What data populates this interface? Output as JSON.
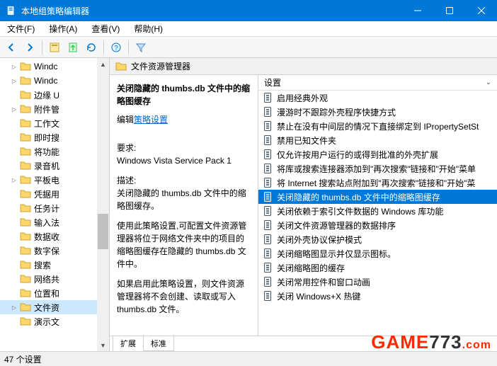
{
  "window": {
    "title": "本地组策略编辑器"
  },
  "menu": {
    "file": "文件(F)",
    "action": "操作(A)",
    "view": "查看(V)",
    "help": "帮助(H)"
  },
  "tree": {
    "items": [
      {
        "label": "Windc",
        "exp": "▷"
      },
      {
        "label": "Windc",
        "exp": "▷"
      },
      {
        "label": "边缘 U",
        "exp": " "
      },
      {
        "label": "附件管",
        "exp": "▷"
      },
      {
        "label": "工作文",
        "exp": " "
      },
      {
        "label": "即时搜",
        "exp": " "
      },
      {
        "label": "将功能",
        "exp": " "
      },
      {
        "label": "录音机",
        "exp": " "
      },
      {
        "label": "平板电",
        "exp": "▷"
      },
      {
        "label": "凭据用",
        "exp": " "
      },
      {
        "label": "任务计",
        "exp": " "
      },
      {
        "label": "输入法",
        "exp": " "
      },
      {
        "label": "数据收",
        "exp": " "
      },
      {
        "label": "数字保",
        "exp": " "
      },
      {
        "label": "搜索",
        "exp": " "
      },
      {
        "label": "网络共",
        "exp": " "
      },
      {
        "label": "位置和",
        "exp": " "
      },
      {
        "label": "文件资",
        "exp": "▷",
        "selected": true
      },
      {
        "label": "演示文",
        "exp": " "
      }
    ]
  },
  "path": {
    "title": "文件资源管理器"
  },
  "desc": {
    "heading": "关闭隐藏的 thumbs.db 文件中的缩略图缓存",
    "edit_prefix": "编辑",
    "edit_link": "策略设置",
    "req_label": "要求:",
    "req_text": "Windows Vista Service Pack 1",
    "desc_label": "描述:",
    "desc_p1": "关闭隐藏的 thumbs.db 文件中的缩略图缓存。",
    "desc_p2": "使用此策略设置,可配置文件资源管理器将位于网络文件夹中的项目的缩略图缓存在隐藏的 thumbs.db 文件中。",
    "desc_p3": "如果启用此策略设置，则文件资源管理器将不会创建、读取或写入 thumbs.db 文件。"
  },
  "listheader": "设置",
  "list": {
    "items": [
      {
        "label": "启用经典外观"
      },
      {
        "label": "漫游时不跟踪外壳程序快捷方式"
      },
      {
        "label": "禁止在没有中间层的情况下直接绑定到 IPropertySetSt"
      },
      {
        "label": "禁用已知文件夹"
      },
      {
        "label": "仅允许按用户运行的或得到批准的外壳扩展"
      },
      {
        "label": "将库或搜索连接器添加到\"再次搜索\"链接和\"开始\"菜单"
      },
      {
        "label": "将 Internet 搜索站点附加到\"再次搜索\"链接和\"开始\"菜"
      },
      {
        "label": "关闭隐藏的 thumbs.db 文件中的缩略图缓存",
        "selected": true
      },
      {
        "label": "关闭依赖于索引文件数据的 Windows 库功能"
      },
      {
        "label": "关闭文件资源管理器的数据排序"
      },
      {
        "label": "关闭外壳协议保护模式"
      },
      {
        "label": "关闭缩略图显示并仅显示图标。"
      },
      {
        "label": "关闭缩略图的缓存"
      },
      {
        "label": "关闭常用控件和窗口动画"
      },
      {
        "label": "关闭 Windows+X 热键"
      }
    ]
  },
  "tabs": {
    "extended": "扩展",
    "standard": "标准"
  },
  "status": "47 个设置"
}
